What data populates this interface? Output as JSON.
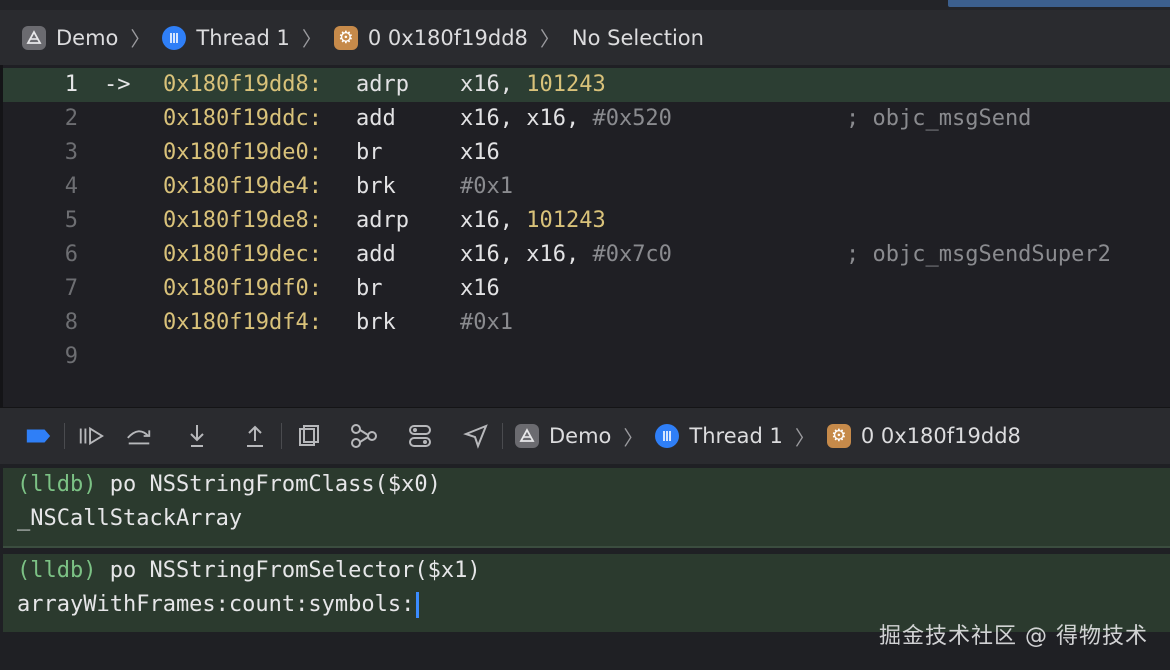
{
  "jumpbar": {
    "app": "Demo",
    "thread": "Thread 1",
    "frame": "0 0x180f19dd8",
    "selection": "No Selection"
  },
  "editor": {
    "lines": [
      {
        "num": "1",
        "arrow": "->",
        "addr": "0x180f19dd8:",
        "op": "adrp",
        "a1": "x16, ",
        "a2": "101243",
        "a3": "",
        "comment": ""
      },
      {
        "num": "2",
        "arrow": "",
        "addr": "0x180f19ddc:",
        "op": "add",
        "a1": "x16, x16, ",
        "a2": "",
        "a3": "#0x520",
        "comment": "; objc_msgSend"
      },
      {
        "num": "3",
        "arrow": "",
        "addr": "0x180f19de0:",
        "op": "br",
        "a1": "x16",
        "a2": "",
        "a3": "",
        "comment": ""
      },
      {
        "num": "4",
        "arrow": "",
        "addr": "0x180f19de4:",
        "op": "brk",
        "a1": "",
        "a2": "",
        "a3": "#0x1",
        "comment": ""
      },
      {
        "num": "5",
        "arrow": "",
        "addr": "0x180f19de8:",
        "op": "adrp",
        "a1": "x16, ",
        "a2": "101243",
        "a3": "",
        "comment": ""
      },
      {
        "num": "6",
        "arrow": "",
        "addr": "0x180f19dec:",
        "op": "add",
        "a1": "x16, x16, ",
        "a2": "",
        "a3": "#0x7c0",
        "comment": "; objc_msgSendSuper2"
      },
      {
        "num": "7",
        "arrow": "",
        "addr": "0x180f19df0:",
        "op": "br",
        "a1": "x16",
        "a2": "",
        "a3": "",
        "comment": ""
      },
      {
        "num": "8",
        "arrow": "",
        "addr": "0x180f19df4:",
        "op": "brk",
        "a1": "",
        "a2": "",
        "a3": "#0x1",
        "comment": ""
      },
      {
        "num": "9",
        "arrow": "",
        "addr": "",
        "op": "",
        "a1": "",
        "a2": "",
        "a3": "",
        "comment": ""
      }
    ]
  },
  "debugbar": {
    "app": "Demo",
    "thread": "Thread 1",
    "frame": "0 0x180f19dd8"
  },
  "console": {
    "entries": [
      {
        "prompt": "(lldb)",
        "command": " po NSStringFromClass($x0)",
        "output": "_NSCallStackArray"
      },
      {
        "prompt": "(lldb)",
        "command": " po NSStringFromSelector($x1)",
        "output": "arrayWithFrames:count:symbols:"
      }
    ]
  },
  "watermark": "掘金技术社区 @ 得物技术",
  "colors": {
    "address": "#d9c27a",
    "prompt": "#7cc285",
    "current_line_bg": "#2c3e33",
    "console_block_bg": "#2b3a2e",
    "accent": "#2f7ff7"
  }
}
